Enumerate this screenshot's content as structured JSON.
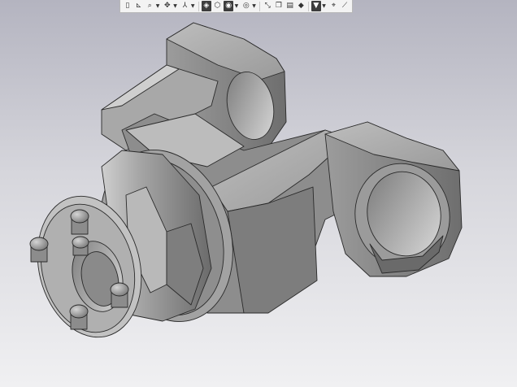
{
  "toolbar": {
    "buttons": [
      {
        "icon": "view-list-icon",
        "glyph": "▯",
        "dropdown": false
      },
      {
        "icon": "orientation-icon",
        "glyph": "⊾",
        "dropdown": false
      },
      {
        "icon": "zoom-icon",
        "glyph": "⌕",
        "dropdown": true
      },
      {
        "icon": "pan-rotate-icon",
        "glyph": "✥",
        "dropdown": true
      },
      {
        "icon": "section-icon",
        "glyph": "⅄",
        "dropdown": true
      },
      {
        "icon": "shaded-icon",
        "glyph": "◈",
        "dropdown": false,
        "active": true
      },
      {
        "icon": "wireframe-cube-icon",
        "glyph": "⬡",
        "dropdown": false
      },
      {
        "icon": "display-style-icon",
        "glyph": "◉",
        "dropdown": true,
        "active": true
      },
      {
        "icon": "hidden-lines-icon",
        "glyph": "◎",
        "dropdown": true
      },
      {
        "icon": "perspective-icon",
        "glyph": "⤡",
        "dropdown": false
      },
      {
        "icon": "copy-view-icon",
        "glyph": "❐",
        "dropdown": false
      },
      {
        "icon": "layers-icon",
        "glyph": "▤",
        "dropdown": false
      },
      {
        "icon": "color-fill-icon",
        "glyph": "◆",
        "dropdown": false
      },
      {
        "icon": "filter-icon",
        "glyph": "▼",
        "dropdown": true,
        "active": true
      },
      {
        "icon": "snap-icon",
        "glyph": "⌖",
        "dropdown": false
      },
      {
        "icon": "measure-icon",
        "glyph": "⟋",
        "dropdown": false
      }
    ]
  },
  "colors": {
    "background_top": "#b4b4c0",
    "background_bottom": "#f0f0f2",
    "model_light": "#b4b4b4",
    "model_mid": "#8a8a8a",
    "model_dark": "#5c5c5c",
    "edge": "#2a2a2a"
  }
}
